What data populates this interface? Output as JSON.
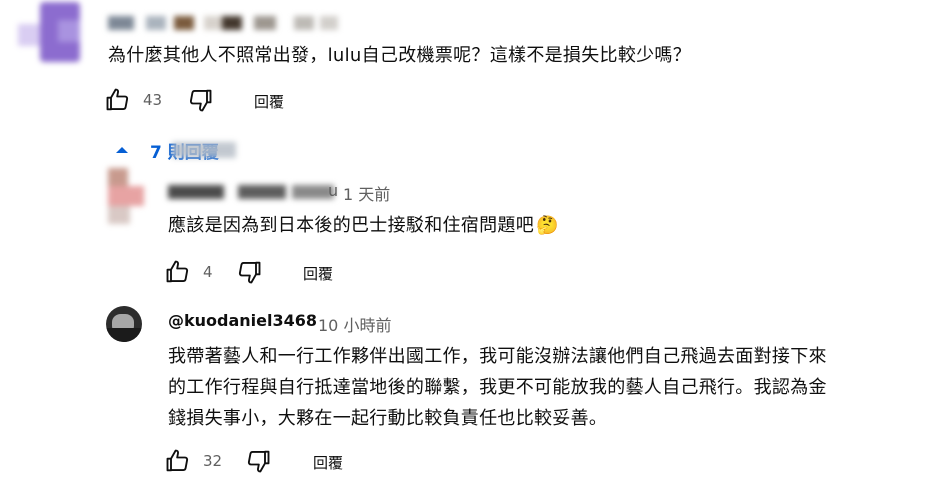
{
  "comments": [
    {
      "text": "為什麼其他人不照常出發，lulu自己改機票呢？這樣不是損失比較少嗎？",
      "likes": "43",
      "reply_label": "回覆",
      "replies_toggle": "7 則回覆"
    }
  ],
  "replies": [
    {
      "handle_suffix": "u",
      "time": "1 天前",
      "text": "應該是因為到日本後的巴士接駁和住宿問題吧",
      "emoji": "🤔",
      "likes": "4",
      "reply_label": "回覆"
    },
    {
      "handle": "@kuodaniel3468",
      "time": "10 小時前",
      "text_lines": [
        "我帶著藝人和一行工作夥伴出國工作，我可能沒辦法讓他們自己飛過去面對接下來",
        "的工作行程與自行抵達當地後的聯繫，我更不可能放我的藝人自己飛行。我認為金",
        "錢損失事小，大夥在一起行動比較負責任也比較妥善。"
      ],
      "likes": "32",
      "reply_label": "回覆"
    }
  ],
  "colors": {
    "avatar_purple": "#8c6ccf",
    "toggle_blue": "#065fd4",
    "avatar_pink": "#e7a3a3"
  }
}
